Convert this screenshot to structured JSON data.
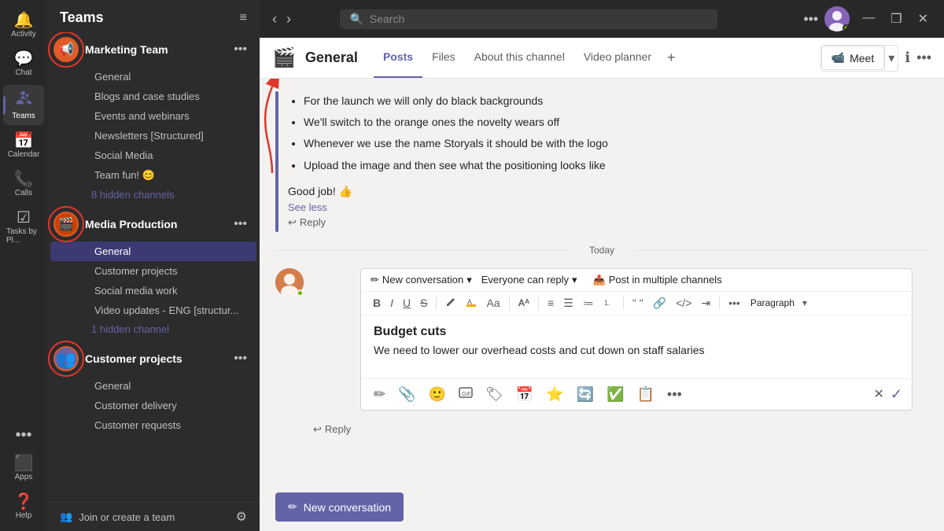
{
  "topbar": {
    "search_placeholder": "Search",
    "dots_label": "•••",
    "minimize": "—",
    "maximize": "❒",
    "close": "✕"
  },
  "nav": {
    "items": [
      {
        "id": "activity",
        "label": "Activity",
        "icon": "🔔"
      },
      {
        "id": "chat",
        "label": "Chat",
        "icon": "💬"
      },
      {
        "id": "teams",
        "label": "Teams",
        "icon": "👥"
      },
      {
        "id": "calendar",
        "label": "Calendar",
        "icon": "📅"
      },
      {
        "id": "calls",
        "label": "Calls",
        "icon": "📞"
      },
      {
        "id": "tasks",
        "label": "Tasks by Pl...",
        "icon": "☑"
      }
    ],
    "bottom": [
      {
        "id": "apps",
        "label": "Apps",
        "icon": "⬛"
      },
      {
        "id": "help",
        "label": "Help",
        "icon": "❓"
      }
    ],
    "more_label": "•••"
  },
  "sidebar": {
    "title": "Teams",
    "filter_icon": "≡",
    "teams": [
      {
        "id": "marketing",
        "name": "Marketing Team",
        "icon": "📢",
        "channels": [
          {
            "name": "General",
            "active": false
          },
          {
            "name": "Blogs and case studies",
            "active": false
          },
          {
            "name": "Events and webinars",
            "active": false
          },
          {
            "name": "Newsletters [Structured]",
            "active": false
          },
          {
            "name": "Social Media",
            "active": false
          },
          {
            "name": "Team fun! 😊",
            "active": false
          }
        ],
        "hidden": "8 hidden channels"
      },
      {
        "id": "media",
        "name": "Media Production",
        "icon": "🎬",
        "channels": [
          {
            "name": "General",
            "active": true
          },
          {
            "name": "Customer projects",
            "active": false
          },
          {
            "name": "Social media work",
            "active": false
          },
          {
            "name": "Video updates - ENG [structur...",
            "active": false
          }
        ],
        "hidden": "1 hidden channel"
      },
      {
        "id": "customer",
        "name": "Customer projects",
        "icon": "👥",
        "channels": [
          {
            "name": "General",
            "active": false
          },
          {
            "name": "Customer delivery",
            "active": false
          },
          {
            "name": "Customer requests",
            "active": false
          }
        ],
        "hidden": null
      }
    ],
    "join_team": "Join or create a team",
    "settings_icon": "⚙"
  },
  "channel": {
    "icon": "🎬",
    "name": "General",
    "tabs": [
      "Posts",
      "Files",
      "About this channel",
      "Video planner"
    ],
    "active_tab": "Posts",
    "meet_label": "Meet",
    "info_icon": "ℹ",
    "more_icon": "•••"
  },
  "messages": {
    "bullets": [
      "For the launch we will only do black backgrounds",
      "We'll switch to the orange ones the novelty wears off",
      "Whenever we use the name Storyals it should be with the logo",
      "Upload the image and then see what the positioning looks like"
    ],
    "good_job": "Good job! 👍",
    "see_less": "See less",
    "reply_label": "Reply",
    "date_divider": "Today"
  },
  "compose": {
    "new_conv_label": "New conversation",
    "new_conv_dropdown": "▾",
    "everyone_reply": "Everyone can reply",
    "everyone_dropdown": "▾",
    "post_multi": "Post in multiple channels",
    "format_bold": "B",
    "format_italic": "I",
    "format_underline": "U",
    "format_strike": "S",
    "format_para": "Paragraph",
    "title": "Budget cuts",
    "body": "We need to lower our overhead costs and cut down on staff salaries",
    "cancel_icon": "✕",
    "send_icon": "✓"
  },
  "new_conv_button": "New conversation"
}
